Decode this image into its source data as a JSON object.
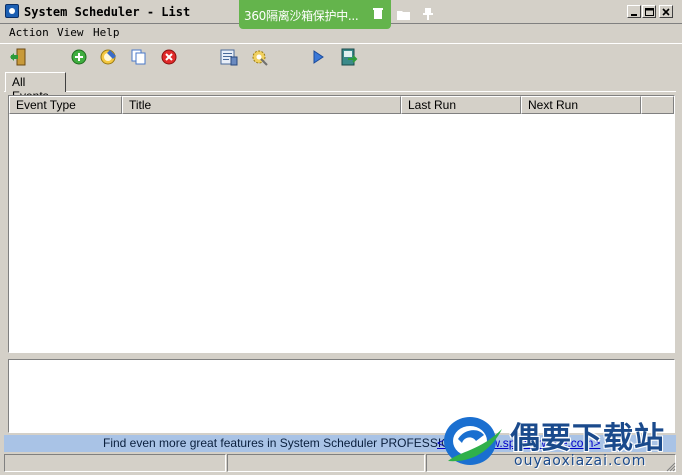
{
  "window": {
    "title": "System Scheduler - List",
    "controls": [
      "minimize",
      "maximize",
      "close"
    ]
  },
  "sandbox_bar": {
    "label": "360隔离沙箱保护中...",
    "color": "#64b44c",
    "icons": [
      "sandbox-bin-icon",
      "sandbox-folder-icon",
      "sandbox-pin-icon"
    ]
  },
  "menu": {
    "items": [
      "Action",
      "View",
      "Help"
    ]
  },
  "toolbar": {
    "buttons": [
      "exit-icon",
      "add-icon",
      "edit-icon",
      "copy-icon",
      "delete-icon",
      "log-icon",
      "settings-icon",
      "run-icon",
      "export-icon"
    ]
  },
  "tabs": {
    "active": "All Events"
  },
  "table": {
    "columns": [
      "Event Type",
      "Title",
      "Last Run",
      "Next Run"
    ],
    "rows": []
  },
  "promo": {
    "text": "Find even more great features in System Scheduler PROFESSIONAL:",
    "link": "<http://www.splinterware.com>",
    "background": "#a9c3e6"
  },
  "watermark": {
    "title": "偶要下载站",
    "subtitle": "ouyaoxiazai.com"
  }
}
